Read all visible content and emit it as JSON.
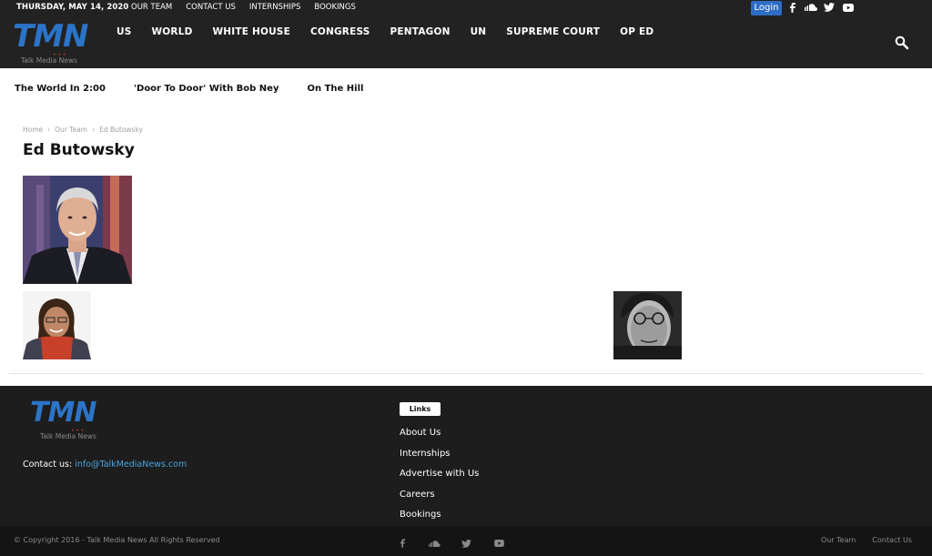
{
  "topbar": {
    "date": "THURSDAY, MAY 14, 2020",
    "links": [
      "OUR TEAM",
      "CONTACT US",
      "INTERNSHIPS",
      "BOOKINGS"
    ],
    "login_label": "Login",
    "social_icons": [
      "facebook-icon",
      "soundcloud-icon",
      "twitter-icon",
      "youtube-icon"
    ]
  },
  "logo": {
    "text": "TMN",
    "tagline": "Talk Media News"
  },
  "nav": {
    "items": [
      "US",
      "WORLD",
      "WHITE HOUSE",
      "CONGRESS",
      "PENTAGON",
      "UN",
      "SUPREME COURT",
      "OP ED"
    ]
  },
  "subnav": {
    "items": [
      "The World In 2:00",
      "'Door To Door' With Bob Ney",
      "On The Hill"
    ]
  },
  "breadcrumb": {
    "items": [
      "Home",
      "Our Team",
      "Ed Butowsky"
    ],
    "separator": "›"
  },
  "page": {
    "title": "Ed Butowsky"
  },
  "footer": {
    "logo_text": "TMN",
    "logo_tagline": "Talk Media News",
    "contact_label": "Contact us:",
    "contact_email": "info@TalkMediaNews.com",
    "links_title": "Links",
    "links": [
      "About Us",
      "Internships",
      "Advertise with Us",
      "Careers",
      "Bookings"
    ]
  },
  "bottombar": {
    "copyright": "© Copyright 2016 - Talk Media News All Rights Reserved",
    "links": [
      "Our Team",
      "Contact Us"
    ]
  },
  "colors": {
    "header_bg": "#222222",
    "accent": "#2b74c8",
    "login_bg": "#2e6dc6",
    "link": "#4aa3df"
  }
}
